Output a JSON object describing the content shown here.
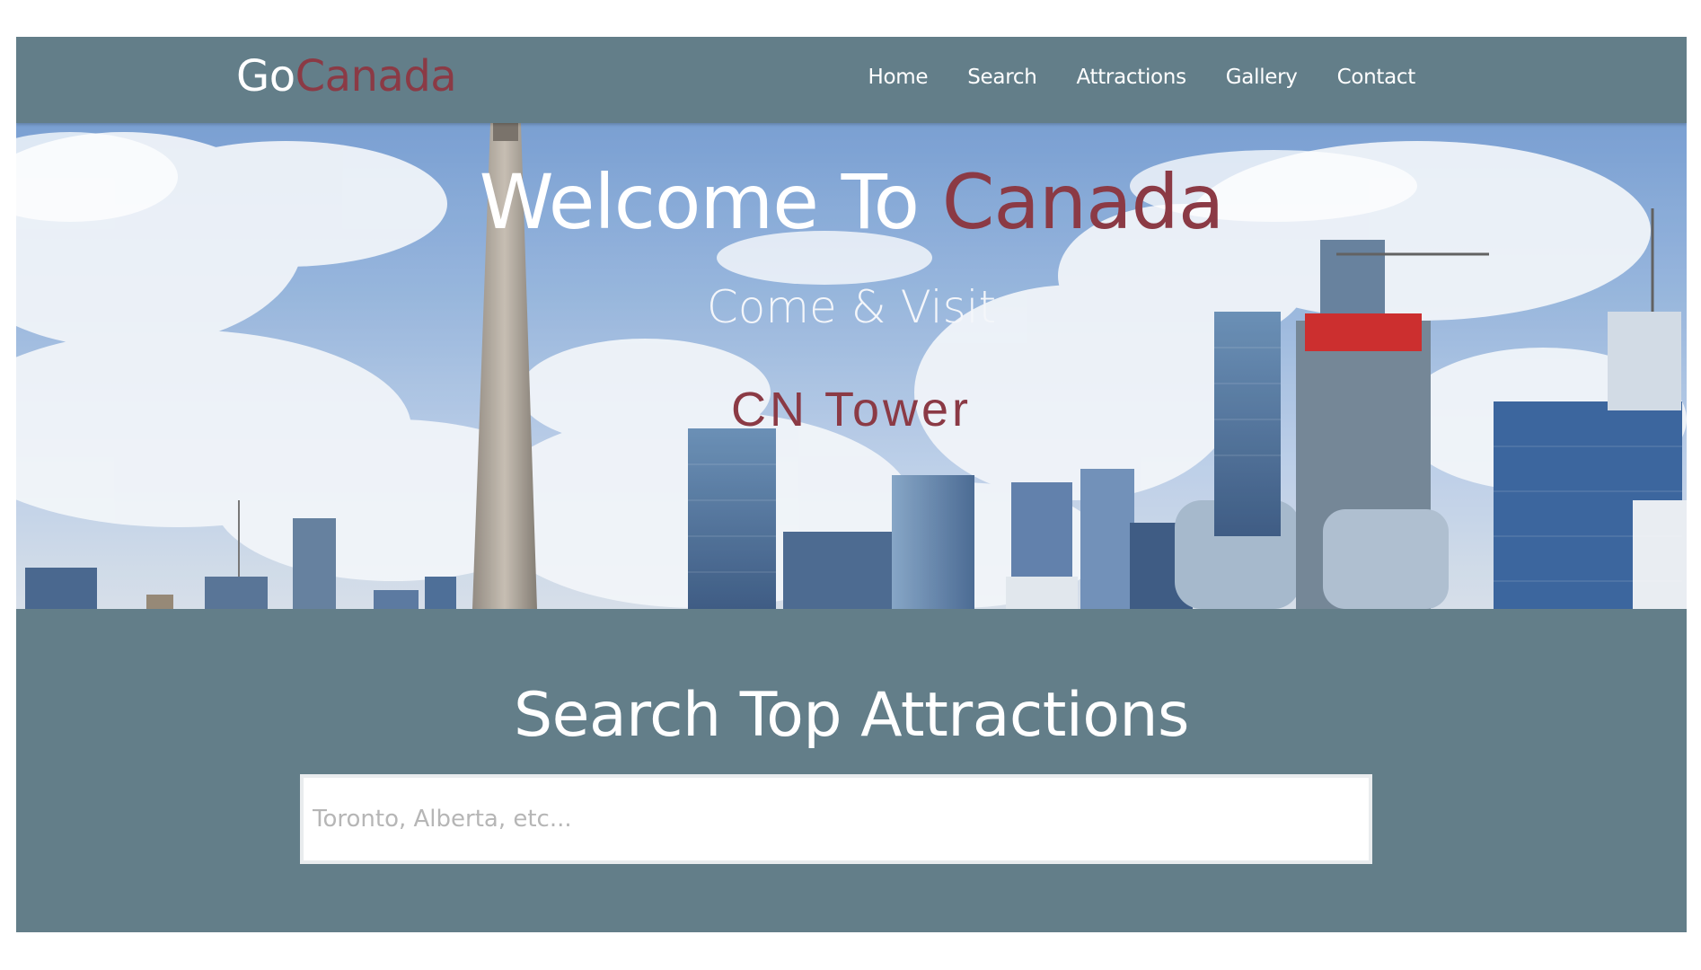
{
  "brand": {
    "prefix": "Go",
    "suffix": "Canada",
    "accent_color": "#8b3a45"
  },
  "nav": {
    "items": [
      {
        "label": "Home"
      },
      {
        "label": "Search"
      },
      {
        "label": "Attractions"
      },
      {
        "label": "Gallery"
      },
      {
        "label": "Contact"
      }
    ]
  },
  "hero": {
    "title_main": "Welcome To ",
    "title_accent": "Canada",
    "subtitle": "Come & Visit",
    "feature": "CN Tower",
    "image_subject": "toronto-skyline-with-cn-tower"
  },
  "search": {
    "heading": "Search Top Attractions",
    "placeholder": "Toronto, Alberta, etc..."
  },
  "colors": {
    "nav_background": "#637e89",
    "accent": "#8b3a45",
    "text": "#ffffff"
  }
}
